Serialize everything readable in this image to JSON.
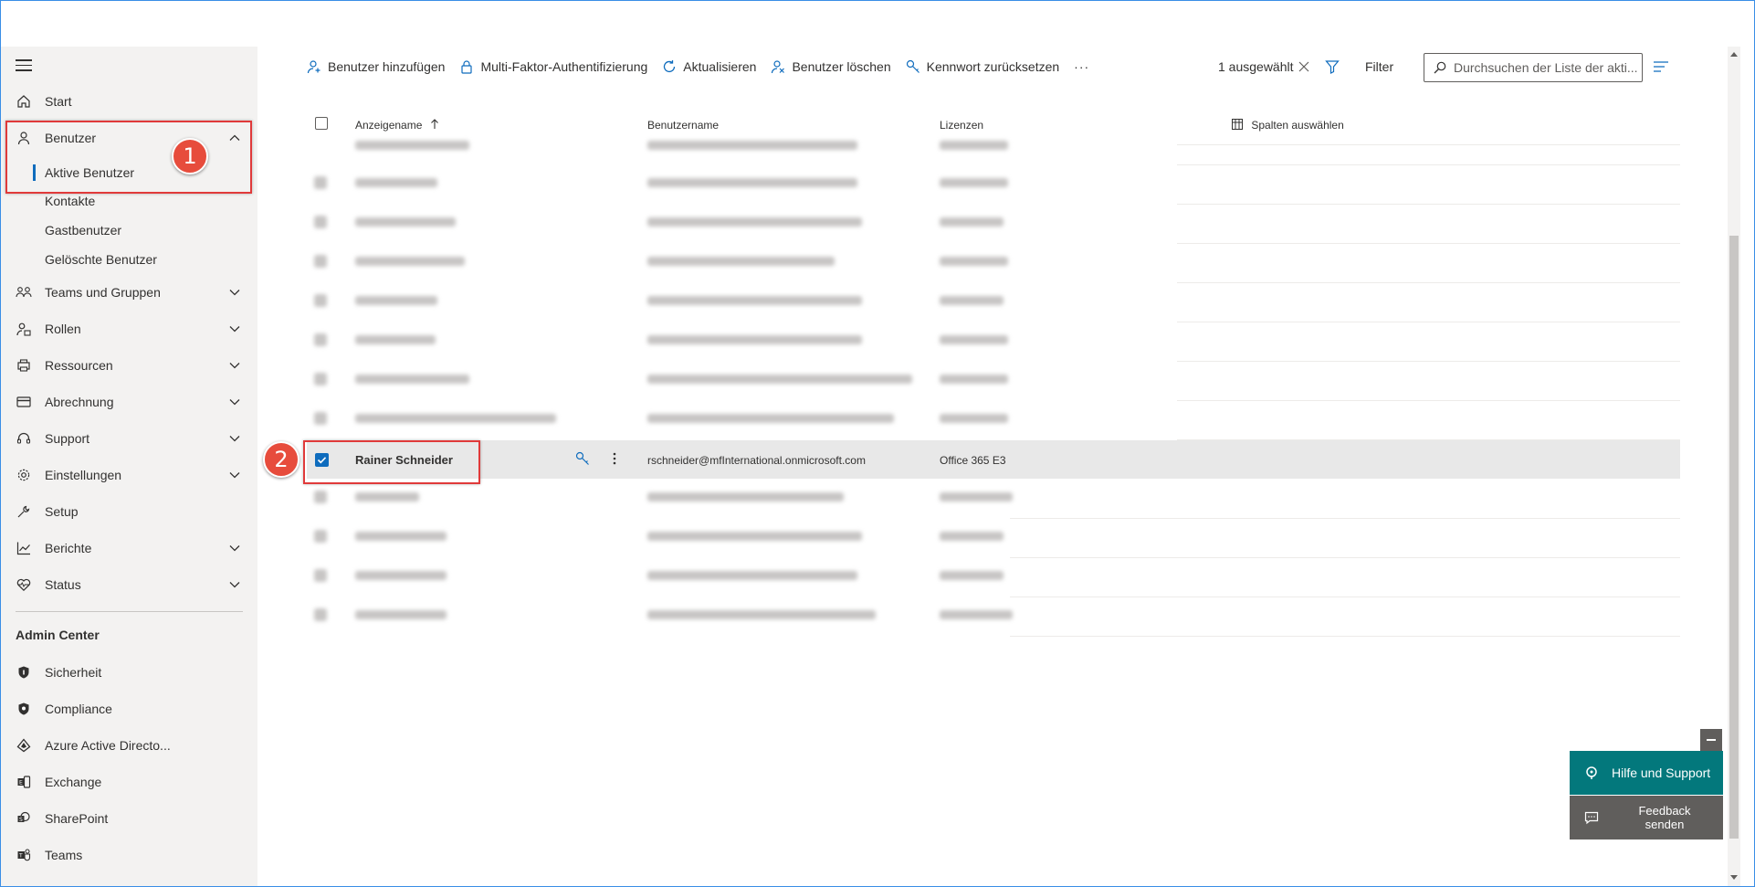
{
  "sidebar": {
    "start": "Start",
    "users": "Benutzer",
    "users_sub": [
      "Aktive Benutzer",
      "Kontakte",
      "Gastbenutzer",
      "Gelöschte Benutzer"
    ],
    "items": [
      "Teams und Gruppen",
      "Rollen",
      "Ressourcen",
      "Abrechnung",
      "Support",
      "Einstellungen",
      "Setup",
      "Berichte",
      "Status"
    ],
    "admin_center_title": "Admin Center",
    "admin_items": [
      "Sicherheit",
      "Compliance",
      "Azure Active Directo...",
      "Exchange",
      "SharePoint",
      "Teams"
    ]
  },
  "toolbar": {
    "add_user": "Benutzer hinzufügen",
    "mfa": "Multi-Faktor-Authentifizierung",
    "refresh": "Aktualisieren",
    "delete_user": "Benutzer löschen",
    "reset_password": "Kennwort zurücksetzen",
    "more": "···",
    "selected_count": "1 ausgewählt",
    "filter": "Filter",
    "search_placeholder": "Durchsuchen der Liste der akti..."
  },
  "table": {
    "headers": {
      "display_name": "Anzeigename",
      "username": "Benutzername",
      "licenses": "Lizenzen",
      "choose_columns": "Spalten auswählen"
    },
    "selected_row": {
      "display_name": "Rainer Schneider",
      "username": "rschneider@mfInternational.onmicrosoft.com",
      "license": "Office 365 E3"
    }
  },
  "annotations": {
    "badge1": "1",
    "badge2": "2"
  },
  "help": {
    "help_support": "Hilfe und Support",
    "feedback_line1": "Feedback",
    "feedback_line2": "senden"
  },
  "colors": {
    "accent": "#0f6cbd",
    "annotation_red": "#e03a3a",
    "help_teal": "#03787c"
  }
}
